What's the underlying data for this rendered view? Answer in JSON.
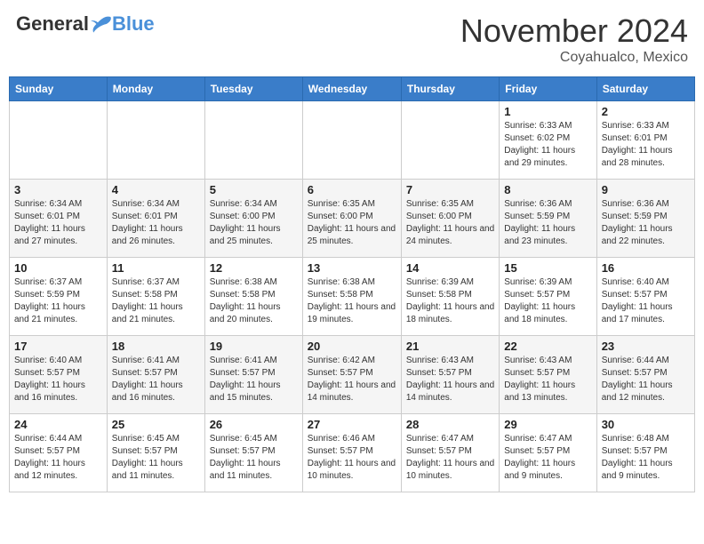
{
  "header": {
    "logo_general": "General",
    "logo_blue": "Blue",
    "month_title": "November 2024",
    "location": "Coyahualco, Mexico"
  },
  "days_of_week": [
    "Sunday",
    "Monday",
    "Tuesday",
    "Wednesday",
    "Thursday",
    "Friday",
    "Saturday"
  ],
  "weeks": [
    [
      {
        "day": "",
        "info": ""
      },
      {
        "day": "",
        "info": ""
      },
      {
        "day": "",
        "info": ""
      },
      {
        "day": "",
        "info": ""
      },
      {
        "day": "",
        "info": ""
      },
      {
        "day": "1",
        "info": "Sunrise: 6:33 AM\nSunset: 6:02 PM\nDaylight: 11 hours and 29 minutes."
      },
      {
        "day": "2",
        "info": "Sunrise: 6:33 AM\nSunset: 6:01 PM\nDaylight: 11 hours and 28 minutes."
      }
    ],
    [
      {
        "day": "3",
        "info": "Sunrise: 6:34 AM\nSunset: 6:01 PM\nDaylight: 11 hours and 27 minutes."
      },
      {
        "day": "4",
        "info": "Sunrise: 6:34 AM\nSunset: 6:01 PM\nDaylight: 11 hours and 26 minutes."
      },
      {
        "day": "5",
        "info": "Sunrise: 6:34 AM\nSunset: 6:00 PM\nDaylight: 11 hours and 25 minutes."
      },
      {
        "day": "6",
        "info": "Sunrise: 6:35 AM\nSunset: 6:00 PM\nDaylight: 11 hours and 25 minutes."
      },
      {
        "day": "7",
        "info": "Sunrise: 6:35 AM\nSunset: 6:00 PM\nDaylight: 11 hours and 24 minutes."
      },
      {
        "day": "8",
        "info": "Sunrise: 6:36 AM\nSunset: 5:59 PM\nDaylight: 11 hours and 23 minutes."
      },
      {
        "day": "9",
        "info": "Sunrise: 6:36 AM\nSunset: 5:59 PM\nDaylight: 11 hours and 22 minutes."
      }
    ],
    [
      {
        "day": "10",
        "info": "Sunrise: 6:37 AM\nSunset: 5:59 PM\nDaylight: 11 hours and 21 minutes."
      },
      {
        "day": "11",
        "info": "Sunrise: 6:37 AM\nSunset: 5:58 PM\nDaylight: 11 hours and 21 minutes."
      },
      {
        "day": "12",
        "info": "Sunrise: 6:38 AM\nSunset: 5:58 PM\nDaylight: 11 hours and 20 minutes."
      },
      {
        "day": "13",
        "info": "Sunrise: 6:38 AM\nSunset: 5:58 PM\nDaylight: 11 hours and 19 minutes."
      },
      {
        "day": "14",
        "info": "Sunrise: 6:39 AM\nSunset: 5:58 PM\nDaylight: 11 hours and 18 minutes."
      },
      {
        "day": "15",
        "info": "Sunrise: 6:39 AM\nSunset: 5:57 PM\nDaylight: 11 hours and 18 minutes."
      },
      {
        "day": "16",
        "info": "Sunrise: 6:40 AM\nSunset: 5:57 PM\nDaylight: 11 hours and 17 minutes."
      }
    ],
    [
      {
        "day": "17",
        "info": "Sunrise: 6:40 AM\nSunset: 5:57 PM\nDaylight: 11 hours and 16 minutes."
      },
      {
        "day": "18",
        "info": "Sunrise: 6:41 AM\nSunset: 5:57 PM\nDaylight: 11 hours and 16 minutes."
      },
      {
        "day": "19",
        "info": "Sunrise: 6:41 AM\nSunset: 5:57 PM\nDaylight: 11 hours and 15 minutes."
      },
      {
        "day": "20",
        "info": "Sunrise: 6:42 AM\nSunset: 5:57 PM\nDaylight: 11 hours and 14 minutes."
      },
      {
        "day": "21",
        "info": "Sunrise: 6:43 AM\nSunset: 5:57 PM\nDaylight: 11 hours and 14 minutes."
      },
      {
        "day": "22",
        "info": "Sunrise: 6:43 AM\nSunset: 5:57 PM\nDaylight: 11 hours and 13 minutes."
      },
      {
        "day": "23",
        "info": "Sunrise: 6:44 AM\nSunset: 5:57 PM\nDaylight: 11 hours and 12 minutes."
      }
    ],
    [
      {
        "day": "24",
        "info": "Sunrise: 6:44 AM\nSunset: 5:57 PM\nDaylight: 11 hours and 12 minutes."
      },
      {
        "day": "25",
        "info": "Sunrise: 6:45 AM\nSunset: 5:57 PM\nDaylight: 11 hours and 11 minutes."
      },
      {
        "day": "26",
        "info": "Sunrise: 6:45 AM\nSunset: 5:57 PM\nDaylight: 11 hours and 11 minutes."
      },
      {
        "day": "27",
        "info": "Sunrise: 6:46 AM\nSunset: 5:57 PM\nDaylight: 11 hours and 10 minutes."
      },
      {
        "day": "28",
        "info": "Sunrise: 6:47 AM\nSunset: 5:57 PM\nDaylight: 11 hours and 10 minutes."
      },
      {
        "day": "29",
        "info": "Sunrise: 6:47 AM\nSunset: 5:57 PM\nDaylight: 11 hours and 9 minutes."
      },
      {
        "day": "30",
        "info": "Sunrise: 6:48 AM\nSunset: 5:57 PM\nDaylight: 11 hours and 9 minutes."
      }
    ]
  ]
}
